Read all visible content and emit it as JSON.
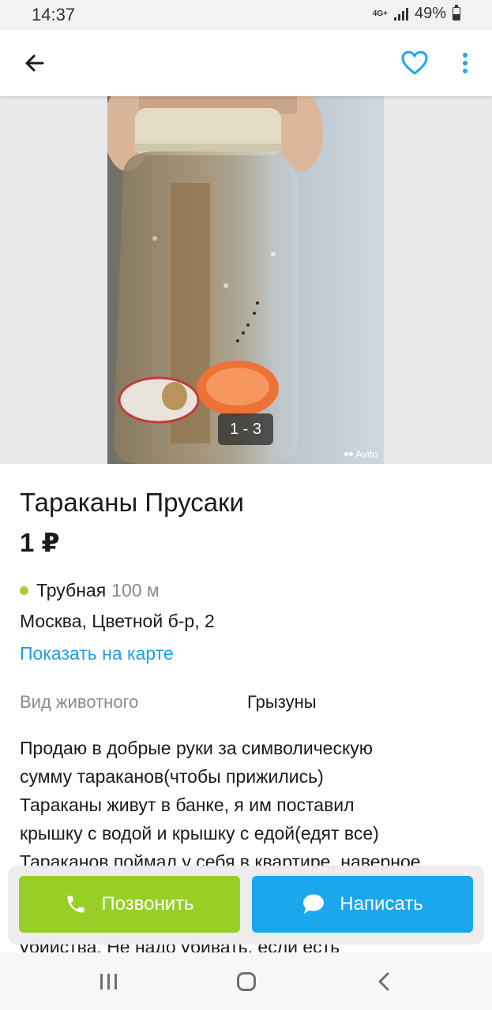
{
  "status": {
    "time": "14:37",
    "network": "4G+",
    "battery": "49%",
    "battery_level": 0.49
  },
  "app_bar": {
    "back_icon": "arrow-left-icon",
    "favorite_icon": "heart-outline-icon",
    "more_icon": "more-vertical-icon",
    "accent": "#1aa7ee"
  },
  "gallery": {
    "counter": "1 - 3",
    "watermark": "Avito"
  },
  "listing": {
    "title": "Тараканы Прусаки",
    "price": "1 ₽",
    "metro_station": "Трубная",
    "metro_distance": "100 м",
    "metro_color": "#a8cc3a",
    "address": "Москва, Цветной б-р, 2",
    "map_link": "Показать на карте",
    "params": [
      {
        "label": "Вид животного",
        "value": "Грызуны"
      }
    ],
    "description_lines": [
      "Продаю в добрые руки за символическую",
      "сумму тараканов(чтобы прижились)",
      "Тараканы живут в банке, я им поставил",
      "крышку с водой и крышку с едой(едят все)",
      "Тараканов поймал у себя в квартире, наверное",
      "убийства. Не надо убивать, если есть"
    ]
  },
  "actions": {
    "call_label": "Позвонить",
    "call_icon": "phone-icon",
    "call_color": "#97cf26",
    "write_label": "Написать",
    "write_icon": "chat-bubble-icon",
    "write_color": "#1aa7ee"
  },
  "nav": {
    "recent_icon": "recent-apps-icon",
    "home_icon": "home-icon",
    "back_icon": "back-chevron-icon"
  }
}
